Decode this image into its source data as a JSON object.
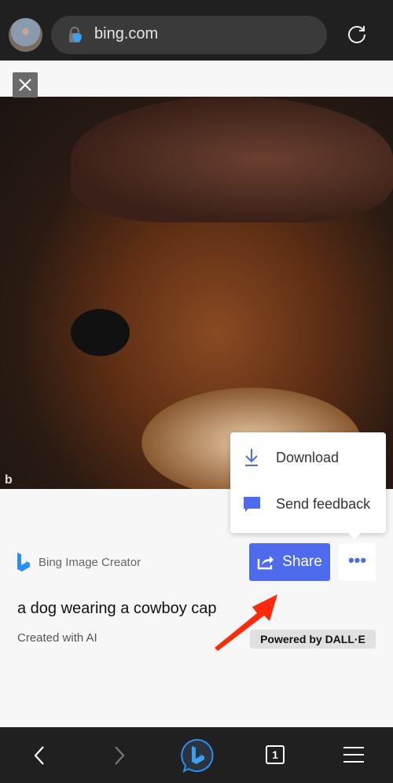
{
  "browser": {
    "url": "bing.com",
    "tab_count": "1"
  },
  "menu": {
    "items": [
      {
        "label": "Download",
        "icon": "download-icon"
      },
      {
        "label": "Send feedback",
        "icon": "feedback-icon"
      }
    ]
  },
  "creator": {
    "brand": "Bing Image Creator",
    "share_label": "Share",
    "more_label": "•••",
    "prompt": "a dog wearing a cowboy cap",
    "created_note": "Created with AI",
    "powered_by": "Powered by DALL·E",
    "watermark": "b"
  },
  "colors": {
    "accent": "#4f6bed",
    "annotation_arrow": "#ff2a0a",
    "bar": "#202020"
  }
}
